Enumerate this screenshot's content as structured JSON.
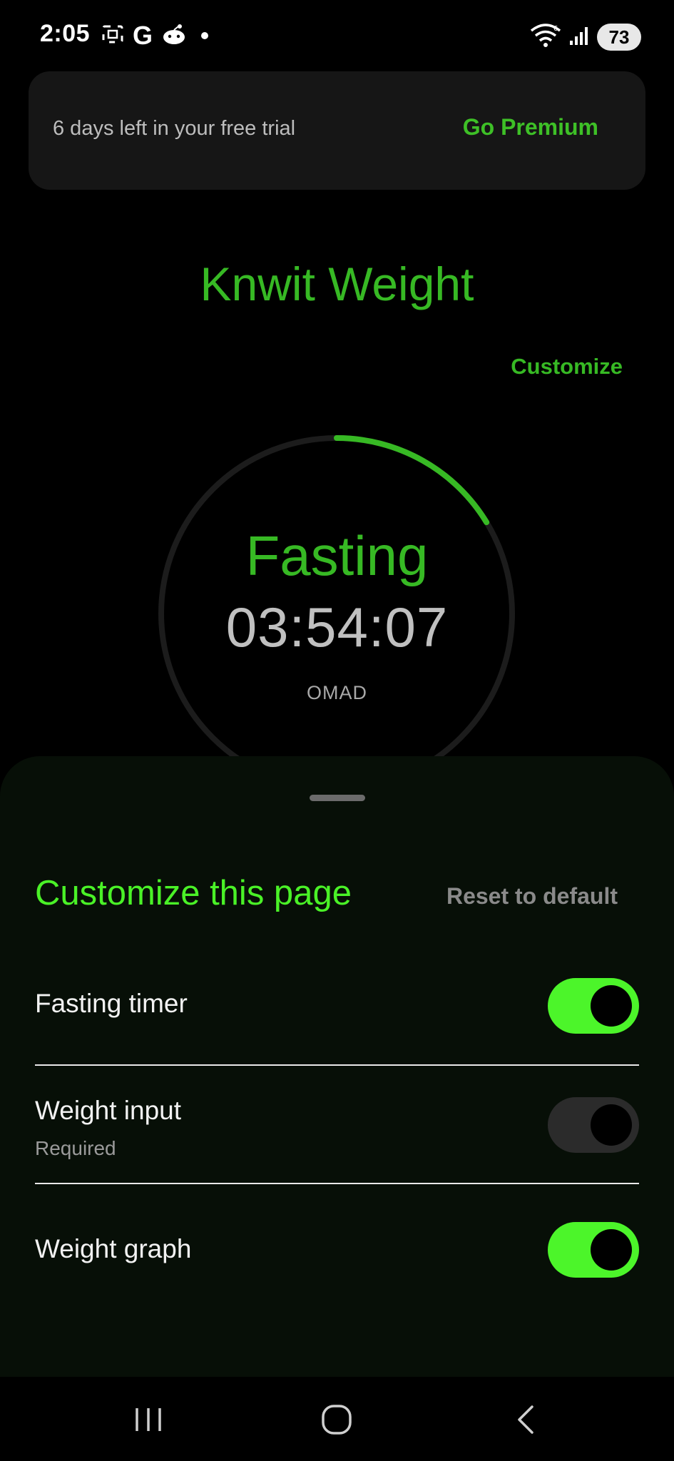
{
  "status_bar": {
    "time": "2:05",
    "google_letter": "G",
    "battery": "73",
    "icons": [
      "screenshot-icon",
      "google-icon",
      "reddit-icon",
      "notification-dot-icon",
      "wifi-icon",
      "signal-icon",
      "battery-icon"
    ]
  },
  "trial_banner": {
    "text": "6 days left in your free trial",
    "cta": "Go Premium"
  },
  "header": {
    "title": "Knwit Weight",
    "customize": "Customize"
  },
  "timer": {
    "state": "Fasting",
    "elapsed": "03:54:07",
    "plan": "OMAD",
    "progress_fraction": 0.163
  },
  "customize_sheet": {
    "title": "Customize this page",
    "reset": "Reset to default",
    "settings": [
      {
        "label": "Fasting timer",
        "sublabel": "",
        "enabled": true
      },
      {
        "label": "Weight input",
        "sublabel": "Required",
        "enabled": false
      },
      {
        "label": "Weight graph",
        "sublabel": "",
        "enabled": true
      }
    ]
  },
  "nav_bar": {
    "buttons": [
      "recent-apps-icon",
      "home-icon",
      "back-icon"
    ]
  },
  "colors": {
    "accent_green": "#37b924",
    "toggle_on": "#4cf52a",
    "sheet_title": "#4af227",
    "background": "#000000",
    "sheet_background": "#070f07",
    "ring_track": "#1c1c1c"
  }
}
